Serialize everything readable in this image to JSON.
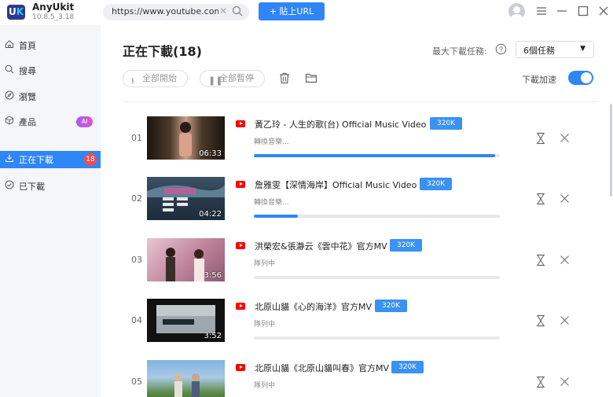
{
  "app": {
    "logo": "U",
    "logo_k": "K",
    "name": "AnyUkit",
    "version": "10.8.5_3.18"
  },
  "url_bar": {
    "value": "https://www.youtube.com/playlist",
    "paste_label": "+ 貼上URL"
  },
  "sidebar": {
    "items": [
      {
        "label": "首頁",
        "icon": "home-icon"
      },
      {
        "label": "搜尋",
        "icon": "search-icon"
      },
      {
        "label": "瀏覽",
        "icon": "compass-icon"
      },
      {
        "label": "產品",
        "icon": "cube-icon",
        "badge": "AI"
      },
      {
        "label": "正在下載",
        "icon": "download-icon",
        "badge": "18",
        "active": true
      },
      {
        "label": "已下載",
        "icon": "check-circle-icon"
      }
    ]
  },
  "main": {
    "title": "正在下載(18)",
    "max_tasks_label": "最大下載任務:",
    "max_tasks_value": "6個任務",
    "start_all": "全部開始",
    "pause_all": "全部暫停",
    "accel_label": "下載加速",
    "accel_on": true
  },
  "downloads": [
    {
      "num": "01",
      "title": "黃乙玲 - 人生的歌(台) Official Music Video",
      "quality": "320K",
      "status": "轉換音樂...",
      "progress": 0.98,
      "duration": "06:33"
    },
    {
      "num": "02",
      "title": "詹雅雯【深情海岸】Official Music Video",
      "quality": "320K",
      "status": "轉換音樂...",
      "progress": 0.18,
      "duration": "04:22"
    },
    {
      "num": "03",
      "title": "洪榮宏&張瀞云《雲中花》官方MV",
      "quality": "320K",
      "status": "隊列中",
      "progress": 0,
      "duration": "3:56"
    },
    {
      "num": "04",
      "title": "北原山貓《心的海洋》官方MV",
      "quality": "320K",
      "status": "隊列中",
      "progress": 0,
      "duration": "3:52"
    },
    {
      "num": "05",
      "title": "北原山貓《北原山貓叫春》官方MV",
      "quality": "320K",
      "status": "隊列中",
      "progress": 0,
      "duration": ""
    }
  ]
}
